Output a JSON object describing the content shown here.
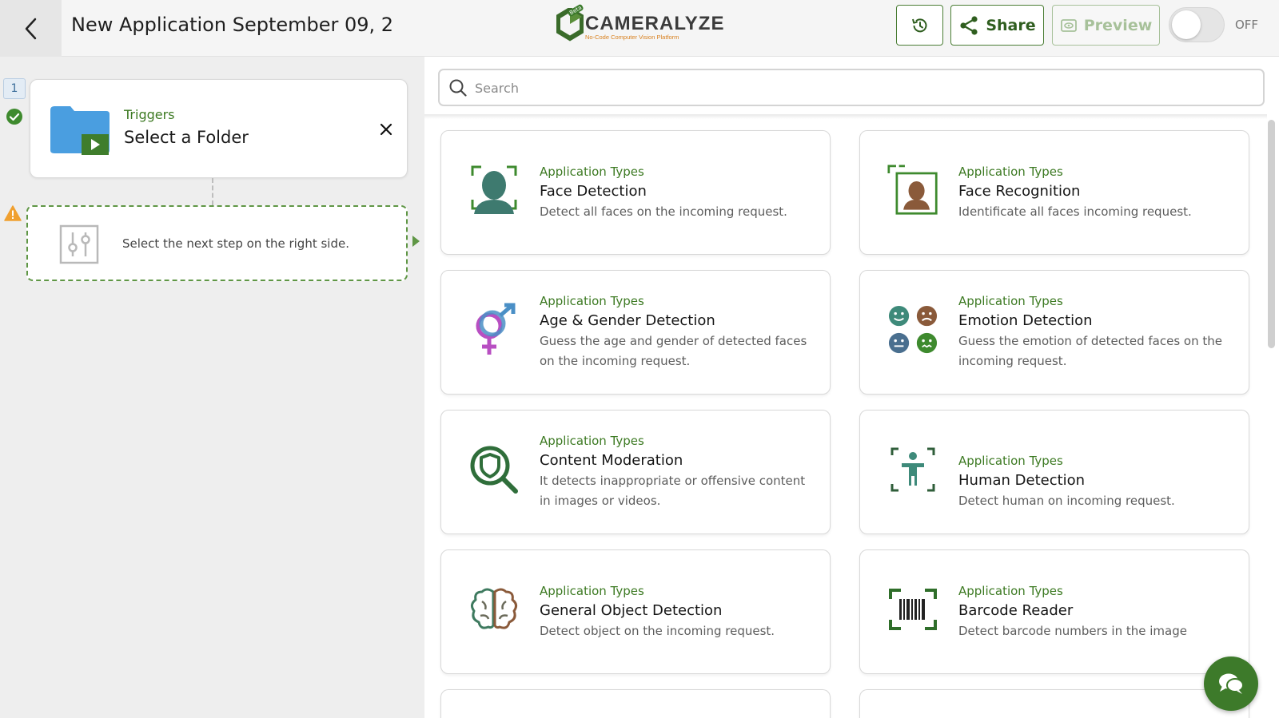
{
  "header": {
    "title": "New Application September 09, 2",
    "logo": {
      "word": "CAMERALYZE",
      "tagline": "No-Code Computer Vision Platform",
      "badge": "Beta"
    },
    "share_label": "Share",
    "preview_label": "Preview",
    "toggle_label": "OFF",
    "toggle_on": false
  },
  "workflow": {
    "step_number": "1",
    "trigger": {
      "label": "Triggers",
      "title": "Select a Folder"
    },
    "next_step_text": "Select the next step on the right side."
  },
  "search": {
    "placeholder": "Search",
    "value": ""
  },
  "cards": [
    {
      "type": "Application Types",
      "title": "Face Detection",
      "desc": "Detect all faces on the incoming request.",
      "icon": "face-detection-icon"
    },
    {
      "type": "Application Types",
      "title": "Face Recognition",
      "desc": "Identificate all faces incoming request.",
      "icon": "face-recognition-icon"
    },
    {
      "type": "Application Types",
      "title": "Age & Gender Detection",
      "desc": "Guess the age and gender of detected faces on the incoming request.",
      "icon": "gender-icon"
    },
    {
      "type": "Application Types",
      "title": "Emotion Detection",
      "desc": "Guess the emotion of detected faces on the incoming request.",
      "icon": "emotion-faces-icon"
    },
    {
      "type": "Application Types",
      "title": "Content Moderation",
      "desc": "It detects inappropriate or offensive content in images or videos.",
      "icon": "content-moderation-icon"
    },
    {
      "type": "Application Types",
      "title": "Human Detection",
      "desc": "Detect human on incoming request.",
      "icon": "human-detection-icon"
    },
    {
      "type": "Application Types",
      "title": "General Object Detection",
      "desc": "Detect object on the incoming request.",
      "icon": "brain-icon"
    },
    {
      "type": "Application Types",
      "title": "Barcode Reader",
      "desc": "Detect barcode numbers in the image",
      "icon": "barcode-icon"
    }
  ],
  "colors": {
    "brand_green": "#3d7a23",
    "accent_orange": "#d8801f",
    "folder_blue": "#4a9ee0"
  }
}
